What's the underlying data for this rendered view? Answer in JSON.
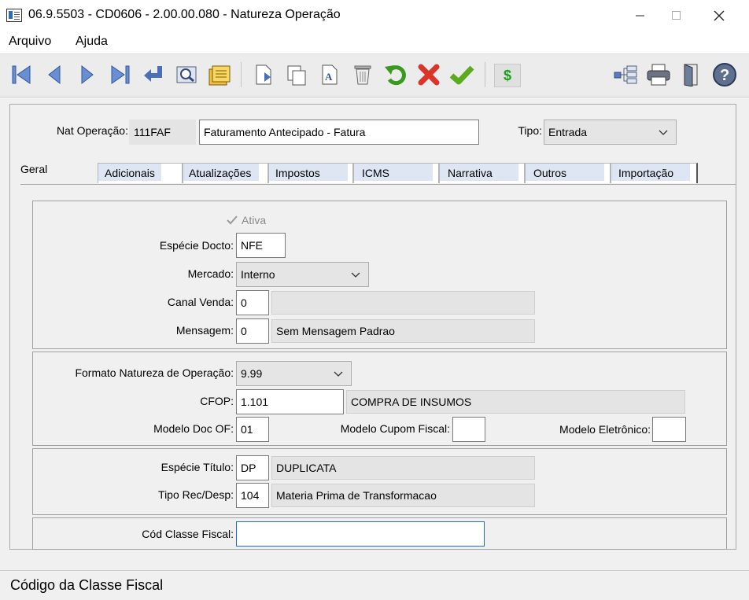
{
  "window": {
    "title": "06.9.5503 - CD0606 - 2.00.00.080 - Natureza Operação"
  },
  "menu": {
    "items": [
      "Arquivo",
      "Ajuda"
    ]
  },
  "toolbar": {
    "icons": [
      "first-record-icon",
      "previous-record-icon",
      "next-record-icon",
      "last-record-icon",
      "goto-record-icon",
      "search-icon",
      "zoom-list-icon",
      "copy-record-icon",
      "new-record-icon",
      "edit-record-icon",
      "delete-record-icon",
      "undo-icon",
      "cancel-icon",
      "save-icon",
      "currency-icon",
      "tree-icon",
      "print-icon",
      "exit-icon",
      "help-icon"
    ],
    "currency_glyph": "$"
  },
  "header": {
    "nat_operacao_label": "Nat Operação:",
    "nat_operacao_code": "111FAF",
    "nat_operacao_desc": "Faturamento Antecipado - Fatura",
    "tipo_label": "Tipo:",
    "tipo_value": "Entrada"
  },
  "tabs": [
    "Geral",
    "Adicionais",
    "Atualizações",
    "Impostos",
    "ICMS",
    "Narrativa",
    "Outros",
    "Importação"
  ],
  "geral": {
    "ativa_label": "Ativa",
    "ativa_checked": true,
    "especie_docto_label": "Espécie Docto:",
    "especie_docto_value": "NFE",
    "mercado_label": "Mercado:",
    "mercado_value": "Interno",
    "canal_venda_label": "Canal Venda:",
    "canal_venda_code": "0",
    "canal_venda_desc": "",
    "mensagem_label": "Mensagem:",
    "mensagem_code": "0",
    "mensagem_desc": "Sem Mensagem Padrao",
    "formato_label": "Formato Natureza de Operação:",
    "formato_value": "9.99",
    "cfop_label": "CFOP:",
    "cfop_value": "1.101",
    "cfop_desc": "COMPRA DE INSUMOS",
    "modelo_doc_label": "Modelo Doc OF:",
    "modelo_doc_value": "01",
    "modelo_cupom_label": "Modelo Cupom Fiscal:",
    "modelo_cupom_value": "",
    "modelo_eletronico_label": "Modelo Eletrônico:",
    "modelo_eletronico_value": "",
    "especie_titulo_label": "Espécie Título:",
    "especie_titulo_code": "DP",
    "especie_titulo_desc": "DUPLICATA",
    "tipo_rec_label": "Tipo Rec/Desp:",
    "tipo_rec_code": "104",
    "tipo_rec_desc": "Materia Prima de Transformacao",
    "cod_classe_label": "Cód Classe Fiscal:",
    "cod_classe_value": ""
  },
  "status": {
    "text": "Código da Classe Fiscal"
  }
}
